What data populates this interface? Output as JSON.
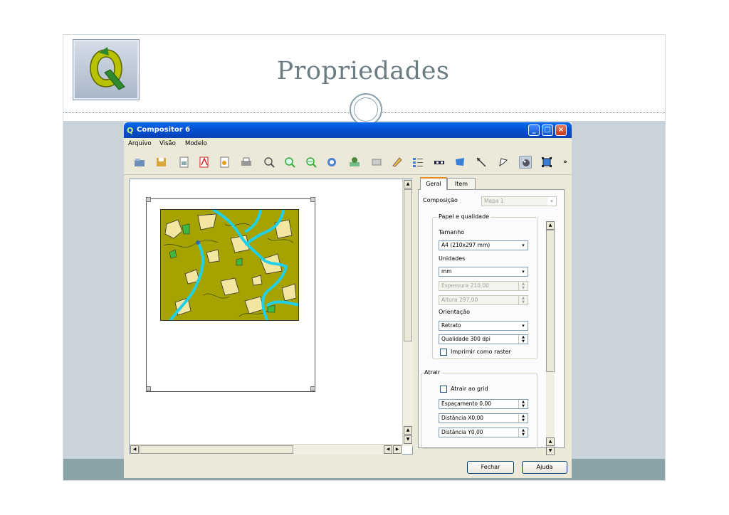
{
  "slide": {
    "title": "Propriedades"
  },
  "window": {
    "title": "Compositor 6",
    "app_icon": "qgis-icon",
    "controls": {
      "minimize": "_",
      "maximize": "□",
      "close": "×"
    }
  },
  "menu": [
    "Arquivo",
    "Visão",
    "Modelo"
  ],
  "toolbar": {
    "more": "»",
    "icons": [
      "open-icon",
      "save-icon",
      "export-image-icon",
      "export-pdf-icon",
      "export-svg-icon",
      "print-icon",
      "zoom-full-icon",
      "zoom-in-icon",
      "zoom-out-icon",
      "refresh-icon",
      "add-map-icon",
      "add-image-icon",
      "add-label-icon",
      "add-legend-icon",
      "add-scalebar-icon",
      "add-shape-icon",
      "add-arrow-icon",
      "add-table-icon",
      "select-move-icon",
      "move-content-icon"
    ]
  },
  "panel": {
    "tabs": [
      "Geral",
      "Item"
    ],
    "composition_label": "Composição",
    "composition_value": "Mapa 1",
    "paper_group": {
      "title": "Papel e qualidade",
      "size_label": "Tamanho",
      "size_value": "A4 (210x297 mm)",
      "units_label": "Unidades",
      "units_value": "mm",
      "width_value": "Espessura 210,00",
      "height_value": "Altura 297,00",
      "orientation_label": "Orientação",
      "orientation_value": "Retrato",
      "quality_value": "Qualidade 300 dpi",
      "raster_label": "Imprimir como raster"
    },
    "snap_group": {
      "title": "Atrair",
      "snap_label": "Atrair ao grid",
      "spacing_value": "Espaçamento 0,00",
      "offset_x_value": "Distância X0,00",
      "offset_y_value": "Distância Y0,00"
    }
  },
  "buttons": {
    "close": "Fechar",
    "help": "Ajuda"
  },
  "colors": {
    "map_fill": "#a6a200",
    "rivers": "#20d0e8",
    "patches_light": "#f3e6a0",
    "patches_green": "#3fb83f",
    "titlebar": "#0552d6"
  }
}
